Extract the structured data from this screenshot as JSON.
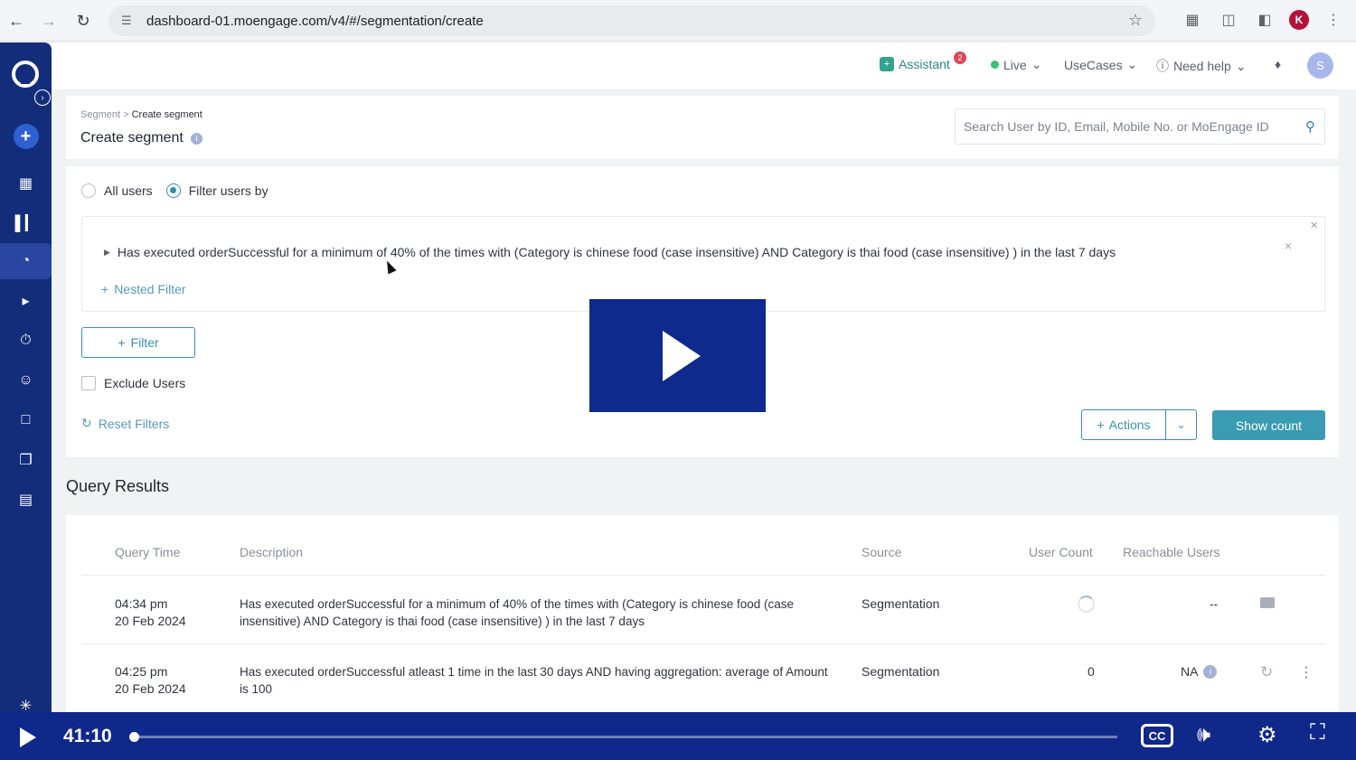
{
  "browser": {
    "url": "dashboard-01.moengage.com/v4/#/segmentation/create",
    "profile_initial": "K"
  },
  "topbar": {
    "assistant_label": "Assistant",
    "assistant_badge": "2",
    "env_label": "Live",
    "usecases_label": "UseCases",
    "help_label": "Need help",
    "avatar_initial": "S"
  },
  "header": {
    "breadcrumb_parent": "Segment",
    "breadcrumb_sep": ">",
    "breadcrumb_current": "Create segment",
    "title": "Create segment",
    "search_placeholder": "Search User by ID, Email, Mobile No. or MoEngage ID"
  },
  "filter": {
    "option_all": "All users",
    "option_filter": "Filter users by",
    "condition_text": "Has executed orderSuccessful for a minimum of 40% of the times with (Category is chinese food (case insensitive) AND Category is thai food (case insensitive) ) in the last 7 days",
    "nested_filter_label": "Nested Filter",
    "filter_button_label": "Filter",
    "exclude_label": "Exclude Users",
    "reset_label": "Reset Filters",
    "actions_label": "Actions",
    "show_count_label": "Show count"
  },
  "results": {
    "title": "Query Results",
    "columns": [
      "Query Time",
      "Description",
      "Source",
      "User Count",
      "Reachable Users"
    ],
    "rows": [
      {
        "time": "04:34 pm",
        "date": "20 Feb 2024",
        "desc_line1": "Has executed orderSuccessful for a minimum of 40% of the times with (Category is chinese food (case",
        "desc_line2": "insensitive) AND Category is thai food (case insensitive) ) in the last 7 days",
        "source": "Segmentation",
        "user_count": "",
        "reachable": "--"
      },
      {
        "time": "04:25 pm",
        "date": "20 Feb 2024",
        "desc_line1": "Has executed orderSuccessful atleast 1 time in the last 30 days AND having aggregation: average of Amount",
        "desc_line2": "is 100",
        "source": "Segmentation",
        "user_count": "0",
        "reachable": "NA"
      }
    ]
  },
  "video": {
    "current_time": "41:10",
    "progress": 0.003,
    "cc_label": "CC"
  },
  "icons": {
    "back": "back-arrow-icon",
    "forward": "forward-arrow-icon",
    "reload": "reload-icon",
    "star": "bookmark-star-icon",
    "play": "play-icon"
  },
  "colors": {
    "sidebar": "#142d7a",
    "accent": "#3a9bb3",
    "video_bar": "#10288a",
    "play_overlay": "#0e2a8c"
  }
}
